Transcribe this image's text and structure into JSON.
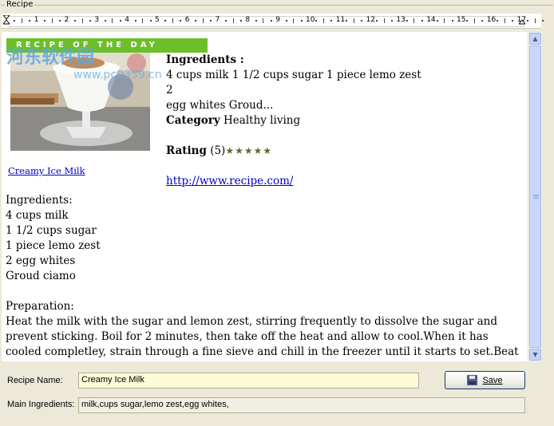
{
  "group": {
    "title": "Recipe"
  },
  "ruler": {
    "numbers": [
      "1",
      "2",
      "3",
      "4",
      "5",
      "6",
      "7",
      "8",
      "9",
      "10",
      "11",
      "12",
      "13",
      "14",
      "15",
      "16",
      "17"
    ]
  },
  "document": {
    "banner_text": "RECIPE OF THE DAY",
    "image_link": "Creamy Ice Milk",
    "ingredients_heading": "Ingredients :",
    "ingredients_summary_line1": "4 cups milk 1 1/2 cups sugar 1 piece lemo zest 2",
    "ingredients_summary_line2": "egg whites Groud...",
    "category_label": "Category",
    "category_value": "Healthy living",
    "rating_label": "Rating",
    "rating_count": "(5)",
    "rating_stars": "★★★★★",
    "url": "http://www.recipe.com/",
    "ingredients_title": "Ingredients:",
    "ingredients": [
      "4 cups milk",
      "1 1/2 cups sugar",
      "1 piece lemo zest",
      "2 egg whites",
      "Groud ciamo"
    ],
    "preparation_title": "Preparation:",
    "preparation_text": "Heat the milk with the sugar and lemon zest, stirring frequently to dissolve the sugar and prevent sticking. Boil for 2 minutes, then take off the heat and allow to cool.When it has cooled completley, strain through a fine sieve and chill in the freezer until it starts to set.Beat the egg whites until stiff, then blend into the mixture. Chill in the fridge for at least 2 hours before serving."
  },
  "form": {
    "recipe_name_label": "Recipe Name:",
    "recipe_name_value": "Creamy Ice Milk",
    "main_ingredients_label": "Main Ingredients:",
    "main_ingredients_value": "milk,cups sugar,lemo zest,egg whites,",
    "save_label": "Save"
  },
  "watermark": {
    "line1": "河东软件园",
    "line2": "www.pc0359.cn"
  },
  "colors": {
    "banner": "#6cbf2a",
    "link": "#0000cc",
    "stars": "#5d6b2e",
    "recipe_name_bg": "#fffad6",
    "main_ingredients_bg": "#f1efe2"
  }
}
